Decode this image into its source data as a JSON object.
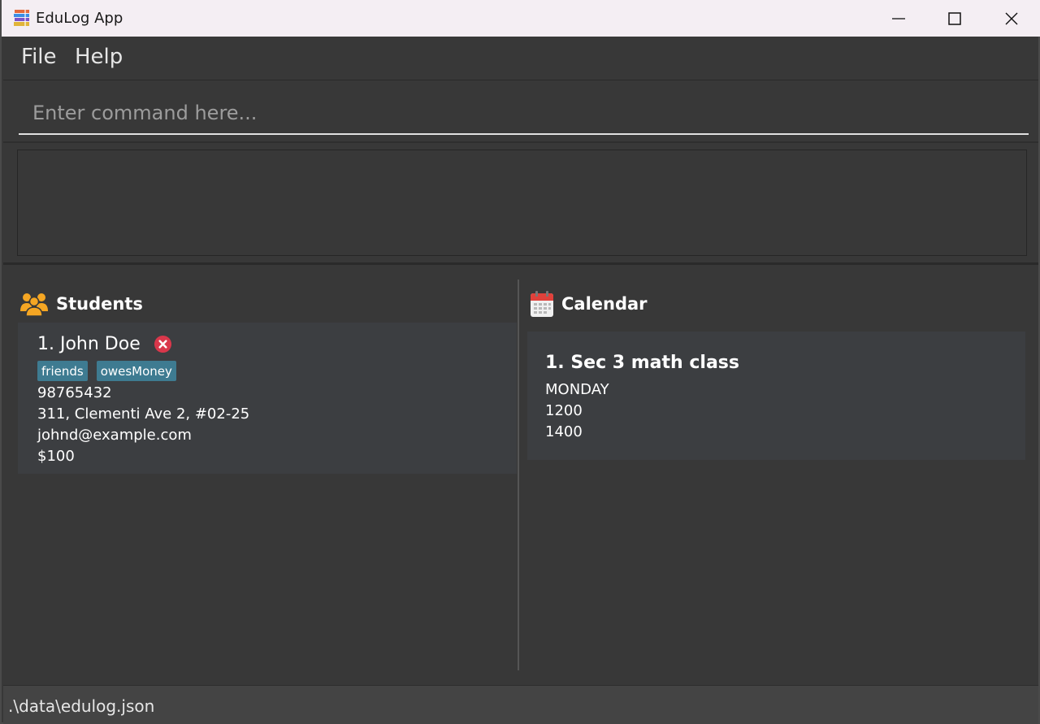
{
  "window": {
    "title": "EduLog App",
    "app_icon": "books-icon"
  },
  "menu": {
    "items": [
      {
        "label": "File"
      },
      {
        "label": "Help"
      }
    ]
  },
  "command": {
    "placeholder": "Enter command here...",
    "value": ""
  },
  "result": {
    "text": ""
  },
  "students_panel": {
    "title": "Students",
    "icon": "people-icon",
    "cards": [
      {
        "index_name": "1. John Doe",
        "tags": [
          "friends",
          "owesMoney"
        ],
        "phone": "98765432",
        "address": "311, Clementi Ave 2, #02-25",
        "email": "johnd@example.com",
        "fee": "$100"
      }
    ]
  },
  "calendar_panel": {
    "title": "Calendar",
    "icon": "calendar-icon",
    "cards": [
      {
        "index_title": "1. Sec 3 math class",
        "day": "MONDAY",
        "start": "1200",
        "end": "1400"
      }
    ]
  },
  "status": {
    "path": ".\\data\\edulog.json"
  },
  "colors": {
    "background": "#383838",
    "card": "#3c3e41",
    "tag": "#3e7b91",
    "delete": "#d9374b"
  }
}
